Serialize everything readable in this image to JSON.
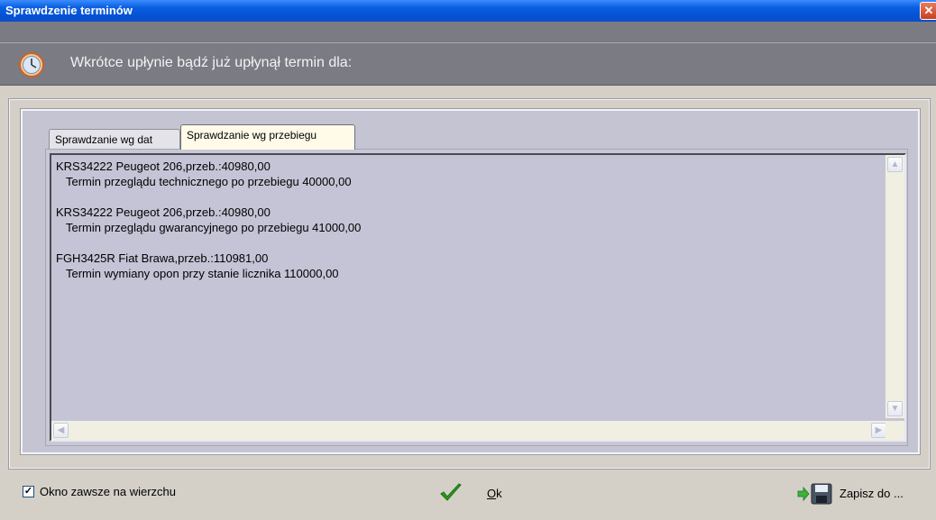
{
  "window": {
    "title": "Sprawdzenie terminów",
    "close_glyph": "✕"
  },
  "header": {
    "message": "Wkrótce upłynie bądź już upłynął termin dla:",
    "icon": "clock-icon"
  },
  "tabs": [
    {
      "label": "Sprawdzanie wg dat",
      "active": false
    },
    {
      "label": "Sprawdzanie wg przebiegu",
      "active": true
    }
  ],
  "entries": [
    {
      "vehicle": "KRS34222 Peugeot 206,przeb.:40980,00",
      "detail": "Termin przeglądu technicznego po przebiegu 40000,00"
    },
    {
      "vehicle": "KRS34222 Peugeot 206,przeb.:40980,00",
      "detail": "Termin przeglądu gwarancyjnego po przebiegu 41000,00"
    },
    {
      "vehicle": "FGH3425R Fiat Brawa,przeb.:110981,00",
      "detail": "Termin wymiany opon przy stanie licznika 110000,00"
    }
  ],
  "footer": {
    "always_on_top_label": "Okno zawsze na wierzchu",
    "always_on_top_checked": true,
    "check_glyph": "✓",
    "ok_accel": "O",
    "ok_rest": "k",
    "save_label": "Zapisz do ..."
  },
  "colors": {
    "titlebar": "#0a5fe0",
    "header_bg": "#7b7b84",
    "list_bg": "#c5c4d6",
    "active_tab": "#fffbe8"
  }
}
